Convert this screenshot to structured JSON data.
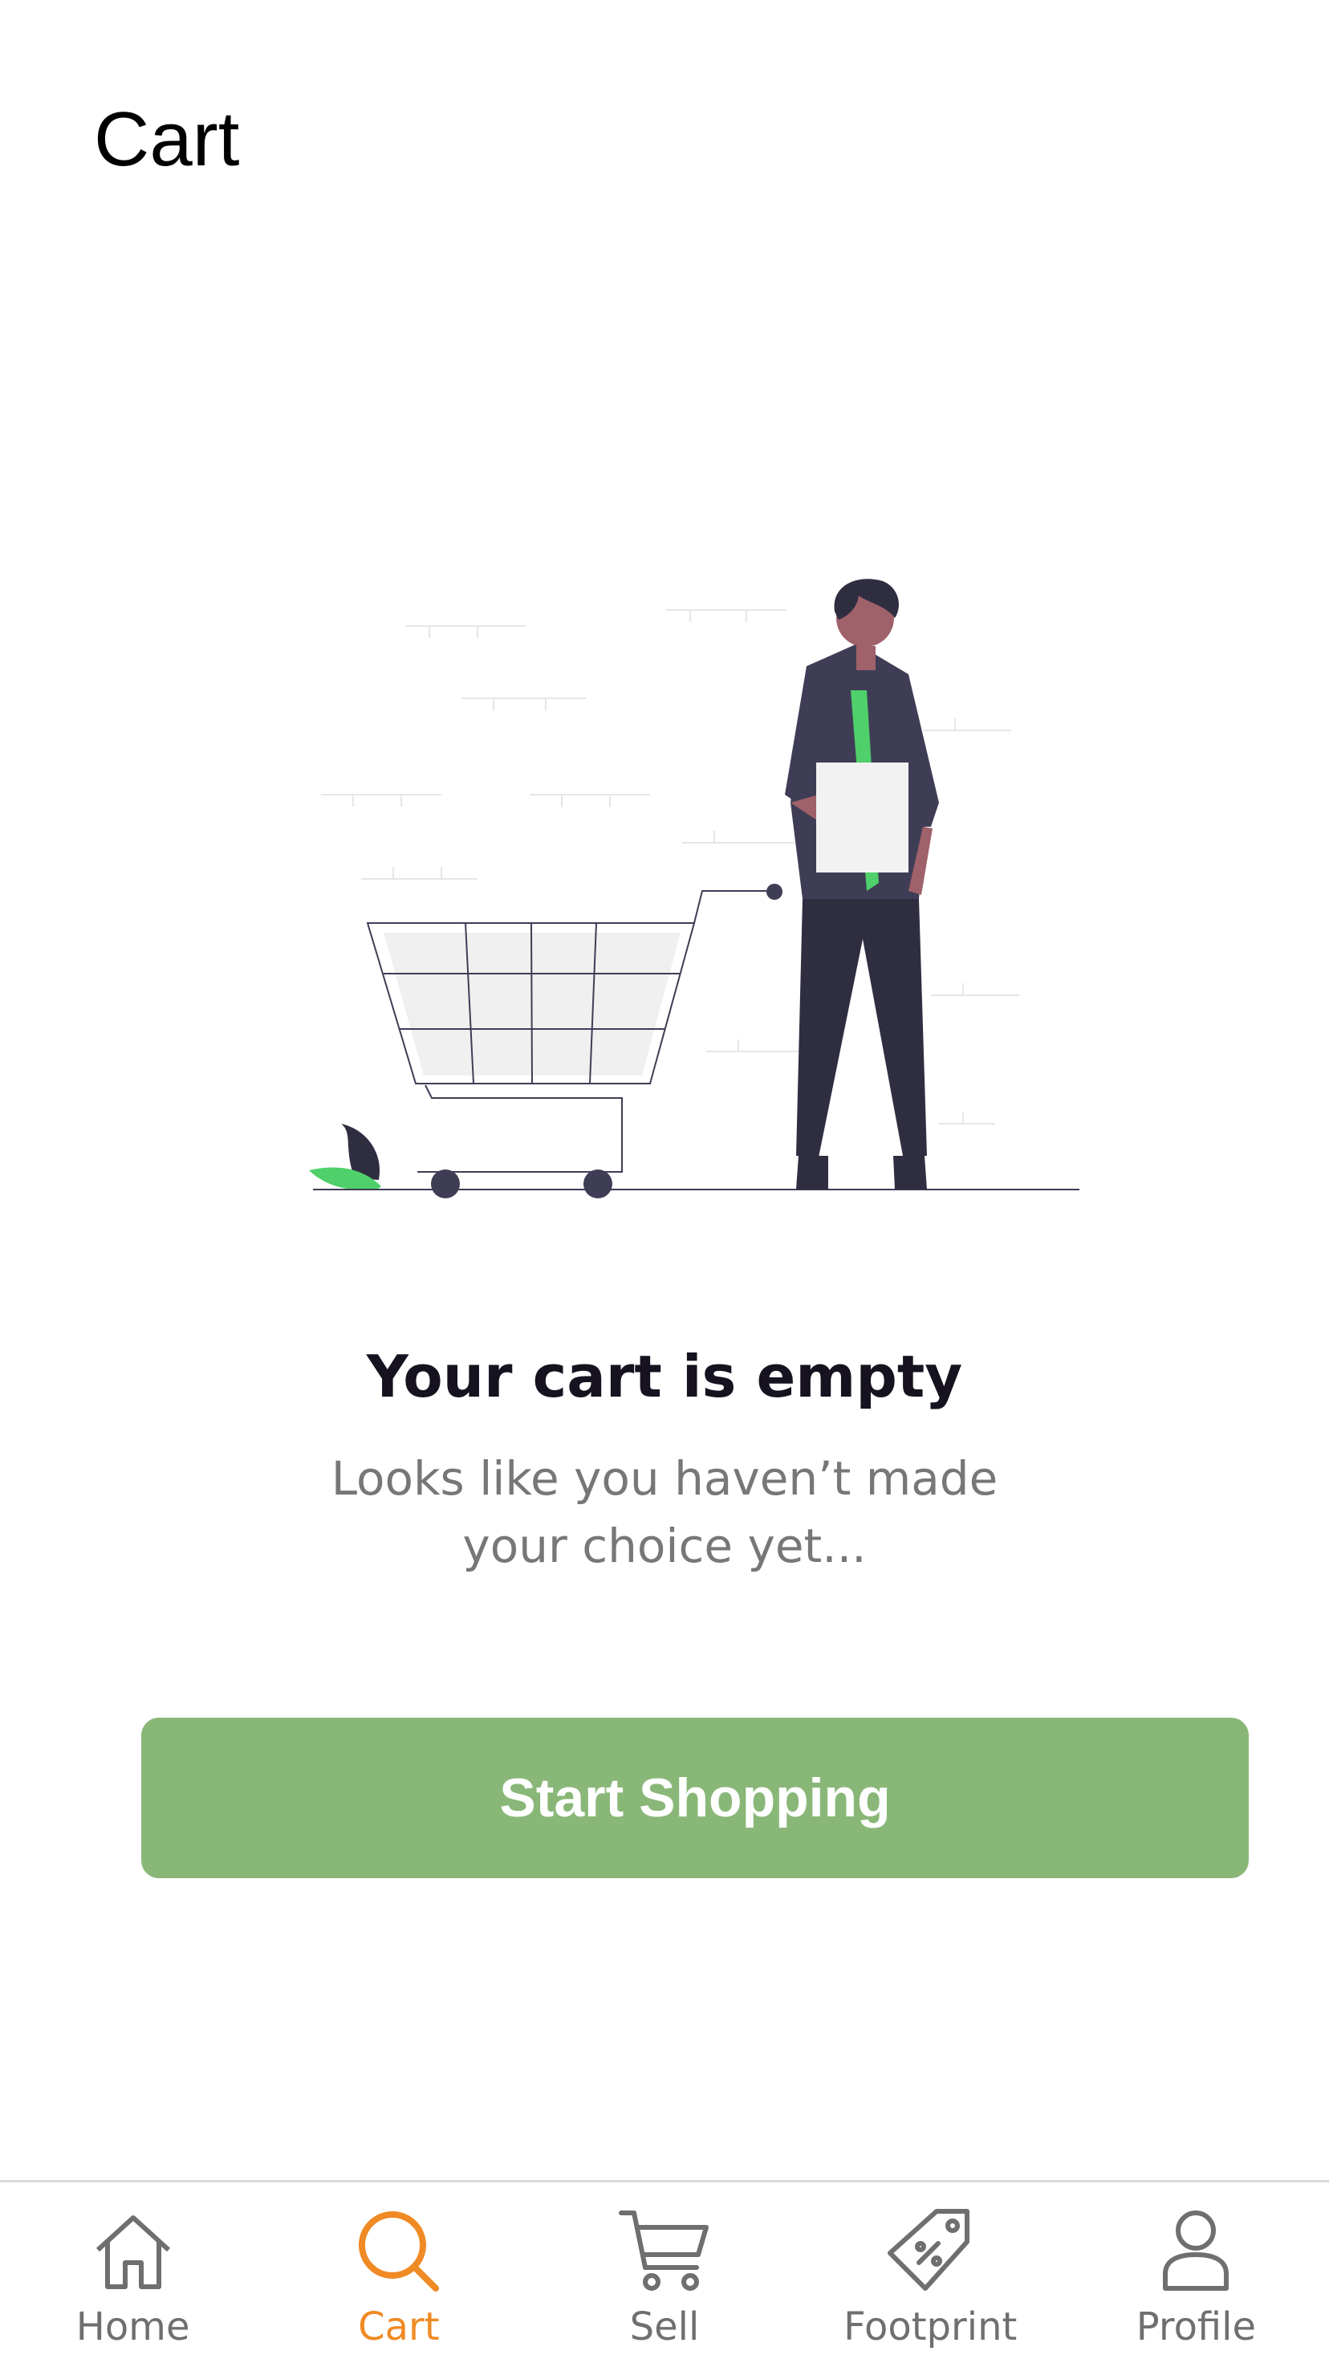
{
  "header": {
    "title": "Cart"
  },
  "empty_state": {
    "illustration_name": "person-with-shopping-cart",
    "title": "Your cart is empty",
    "subtitle_lines": [
      "Looks like you haven’t made",
      "your choice yet..."
    ],
    "button_label": "Start Shopping"
  },
  "colors": {
    "primary_button": "#89b778",
    "active_tab": "#f08a24",
    "inactive_tab": "#6f6f6f",
    "accent_green": "#4fd06a",
    "dark_figure": "#3f3d56"
  },
  "bottom_nav": {
    "items": [
      {
        "label": "Home",
        "icon": "home-icon",
        "active": false
      },
      {
        "label": "Cart",
        "icon": "search-icon",
        "active": true
      },
      {
        "label": "Sell",
        "icon": "cart-icon",
        "active": false
      },
      {
        "label": "Footprint",
        "icon": "tag-icon",
        "active": false
      },
      {
        "label": "Profile",
        "icon": "person-icon",
        "active": false
      }
    ]
  }
}
